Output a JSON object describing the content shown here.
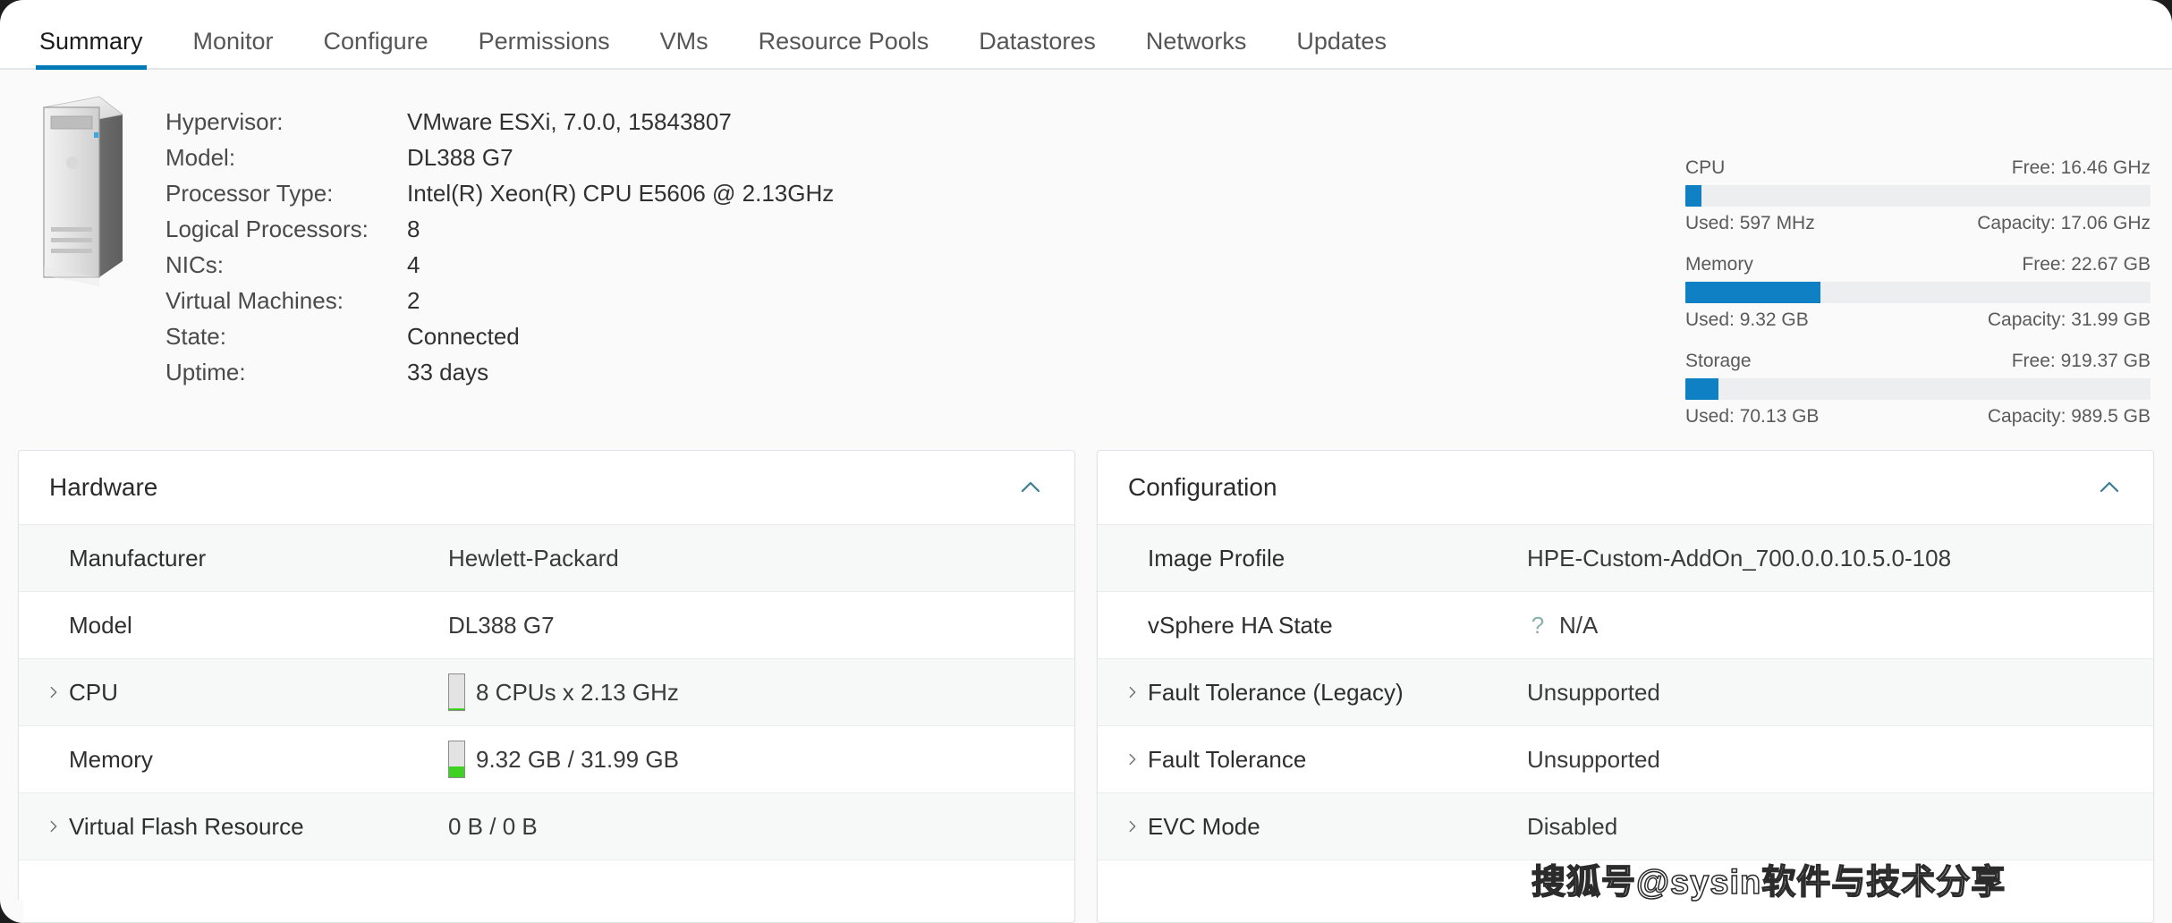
{
  "tabs": [
    {
      "label": "Summary",
      "active": true
    },
    {
      "label": "Monitor",
      "active": false
    },
    {
      "label": "Configure",
      "active": false
    },
    {
      "label": "Permissions",
      "active": false
    },
    {
      "label": "VMs",
      "active": false
    },
    {
      "label": "Resource Pools",
      "active": false
    },
    {
      "label": "Datastores",
      "active": false
    },
    {
      "label": "Networks",
      "active": false
    },
    {
      "label": "Updates",
      "active": false
    }
  ],
  "accent_color": "#0079b8",
  "host_icon_name": "esxi-host-server-icon",
  "host_fields": [
    {
      "label": "Hypervisor:",
      "value": "VMware ESXi, 7.0.0, 15843807"
    },
    {
      "label": "Model:",
      "value": "DL388 G7"
    },
    {
      "label": "Processor Type:",
      "value": "Intel(R) Xeon(R) CPU E5606 @ 2.13GHz"
    },
    {
      "label": "Logical Processors:",
      "value": "8"
    },
    {
      "label": "NICs:",
      "value": "4"
    },
    {
      "label": "Virtual Machines:",
      "value": "2"
    },
    {
      "label": "State:",
      "value": "Connected"
    },
    {
      "label": "Uptime:",
      "value": "33 days"
    }
  ],
  "meters": [
    {
      "name": "CPU",
      "free_label": "Free: 16.46 GHz",
      "used_label": "Used: 597 MHz",
      "capacity_label": "Capacity: 17.06 GHz",
      "percent": 3.5,
      "fill_color": "#0f80c3"
    },
    {
      "name": "Memory",
      "free_label": "Free: 22.67 GB",
      "used_label": "Used: 9.32 GB",
      "capacity_label": "Capacity: 31.99 GB",
      "percent": 29.1,
      "fill_color": "#0f80c3"
    },
    {
      "name": "Storage",
      "free_label": "Free: 919.37 GB",
      "used_label": "Used: 70.13 GB",
      "capacity_label": "Capacity: 989.5 GB",
      "percent": 7.1,
      "fill_color": "#0f80c3"
    }
  ],
  "hardware_card": {
    "title": "Hardware",
    "collapse_icon": "chevron-up-icon",
    "rows": [
      {
        "label": "Manufacturer",
        "value": "Hewlett-Packard",
        "expandable": false,
        "gauge": null
      },
      {
        "label": "Model",
        "value": "DL388 G7",
        "expandable": false,
        "gauge": null
      },
      {
        "label": "CPU",
        "value": "8 CPUs x 2.13 GHz",
        "expandable": true,
        "gauge": 6
      },
      {
        "label": "Memory",
        "value": "9.32 GB / 31.99 GB",
        "expandable": false,
        "gauge": 30
      },
      {
        "label": "Virtual Flash Resource",
        "value": "0 B / 0 B",
        "expandable": true,
        "gauge": null
      }
    ]
  },
  "configuration_card": {
    "title": "Configuration",
    "collapse_icon": "chevron-up-icon",
    "rows": [
      {
        "label": "Image Profile",
        "value": "HPE-Custom-AddOn_700.0.0.10.5.0-108",
        "expandable": false,
        "help": false
      },
      {
        "label": "vSphere HA State",
        "value": "N/A",
        "expandable": false,
        "help": true
      },
      {
        "label": "Fault Tolerance (Legacy)",
        "value": "Unsupported",
        "expandable": true,
        "help": false
      },
      {
        "label": "Fault Tolerance",
        "value": "Unsupported",
        "expandable": true,
        "help": false
      },
      {
        "label": "EVC Mode",
        "value": "Disabled",
        "expandable": true,
        "help": false
      }
    ]
  },
  "watermark": {
    "text": "搜狐号@sysin软件与技术分享"
  }
}
